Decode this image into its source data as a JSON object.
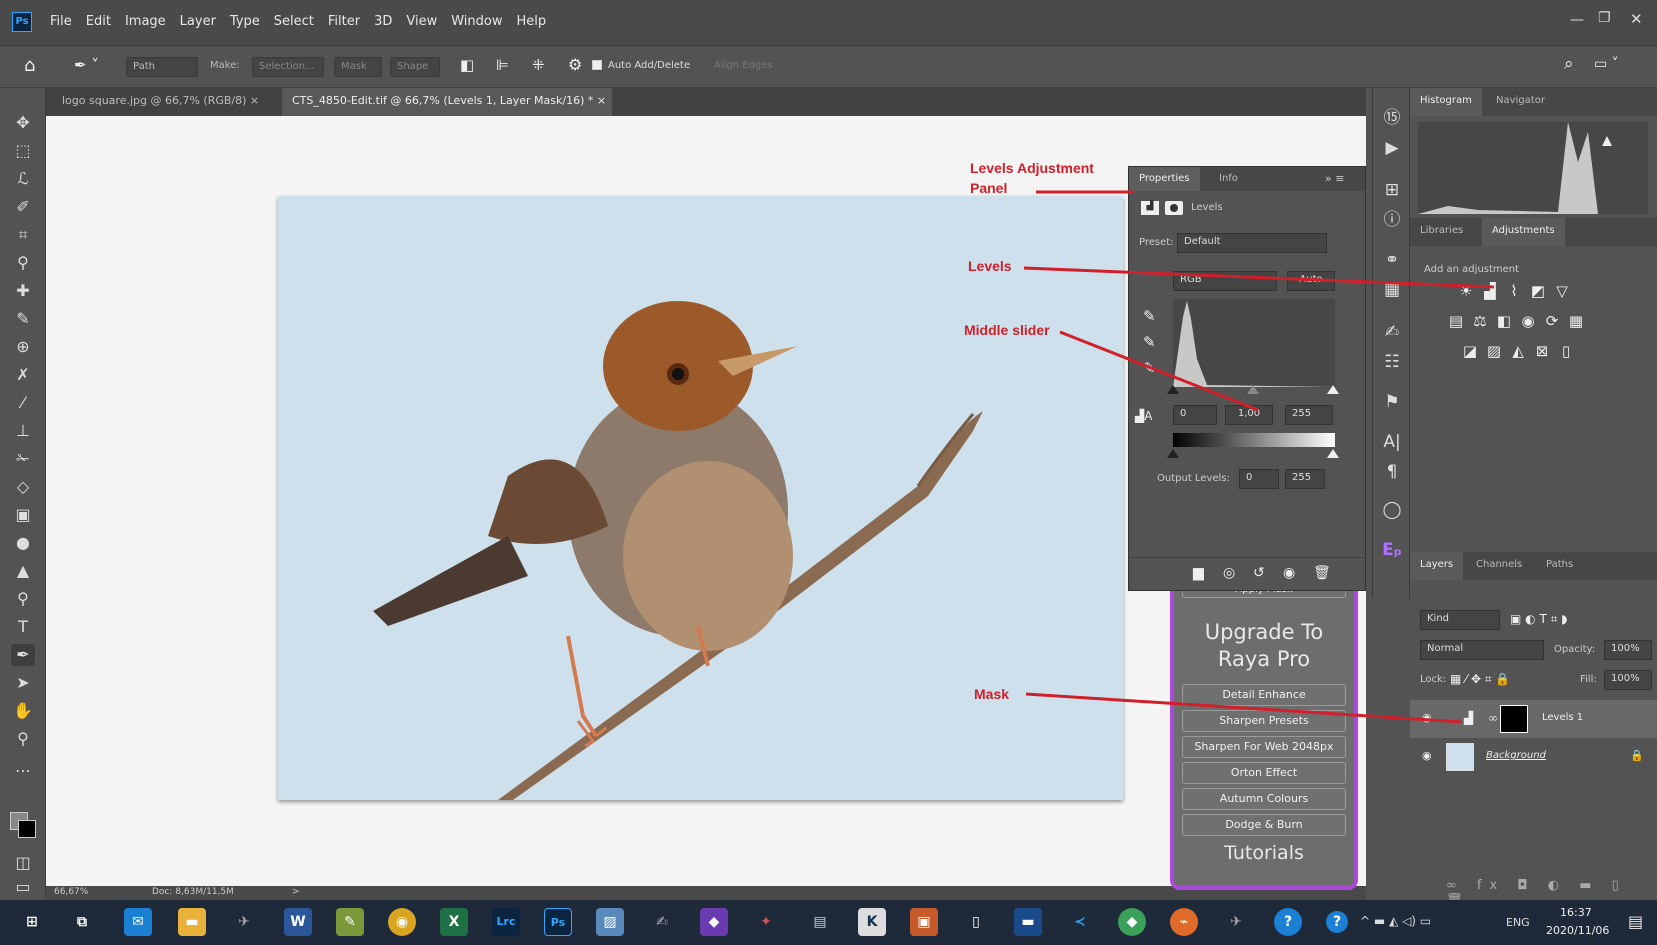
{
  "app": {
    "logo": "Ps",
    "menu": [
      "File",
      "Edit",
      "Image",
      "Layer",
      "Type",
      "Select",
      "Filter",
      "3D",
      "View",
      "Window",
      "Help"
    ]
  },
  "options": {
    "path_mode": "Path",
    "make_label": "Make:",
    "selection_btn": "Selection...",
    "mask_btn": "Mask",
    "shape_btn": "Shape",
    "auto_add": "Auto Add/Delete",
    "align_edges": "Align Edges"
  },
  "tabs": [
    {
      "label": "logo square.jpg @ 66,7% (RGB/8)",
      "close": "×"
    },
    {
      "label": "CTS_4850-Edit.tif @ 66,7% (Levels 1, Layer Mask/16) *",
      "close": "×"
    }
  ],
  "status": {
    "zoom": "66,67%",
    "doc": "Doc: 8,63M/11,5M",
    "arrow": ">"
  },
  "properties": {
    "tabs": [
      "Properties",
      "Info"
    ],
    "header": "Levels",
    "preset_label": "Preset:",
    "preset_value": "Default",
    "channel": "RGB",
    "auto": "Auto",
    "input_black": "0",
    "input_mid": "1,00",
    "input_white": "255",
    "output_label": "Output Levels:",
    "output_black": "0",
    "output_white": "255"
  },
  "right": {
    "top_tabs": [
      "Histogram",
      "Navigator"
    ],
    "mid_tabs": [
      "Libraries",
      "Adjustments"
    ],
    "add_adjustment": "Add an adjustment",
    "layer_tabs": [
      "Layers",
      "Channels",
      "Paths"
    ],
    "kind": "Kind",
    "blend": "Normal",
    "opacity_label": "Opacity:",
    "opacity": "100%",
    "lock_label": "Lock:",
    "fill_label": "Fill:",
    "fill": "100%",
    "layers": [
      {
        "name": "Levels 1"
      },
      {
        "name": "Background"
      }
    ]
  },
  "raya": {
    "top_cut": "Apply Mask",
    "upgrade": "Upgrade To",
    "pro": "Raya Pro",
    "buttons": [
      "Detail Enhance",
      "Sharpen Presets",
      "Sharpen For Web 2048px",
      "Orton Effect",
      "Autumn Colours",
      "Dodge & Burn"
    ],
    "tutorials": "Tutorials"
  },
  "annotations": {
    "levels_panel": "Levels Adjustment",
    "levels_panel2": "Panel",
    "levels": "Levels",
    "middle_slider": "Middle slider",
    "mask": "Mask"
  },
  "taskbar": {
    "lang": "ENG",
    "time": "16:37",
    "date": "2020/11/06"
  },
  "colors": {
    "annotation": "#d0202a",
    "raya_border": "#a94bd8",
    "taskbar": "#1e2a3a"
  }
}
